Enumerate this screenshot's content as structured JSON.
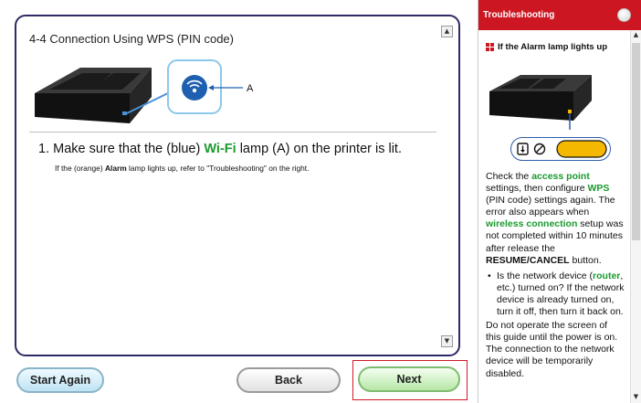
{
  "main": {
    "title": "4-4 Connection Using WPS (PIN code)",
    "callout_label": "A",
    "step": {
      "number": "1.",
      "text_before": "Make sure that the (blue) ",
      "text_highlight": "Wi-Fi",
      "text_after": " lamp (A) on the printer is lit."
    },
    "note": {
      "before": "If the (orange) ",
      "bold": "Alarm",
      "after": " lamp lights up, refer to \"Troubleshooting\" on the right."
    }
  },
  "buttons": {
    "start_again": "Start Again",
    "back": "Back",
    "next": "Next"
  },
  "troubleshooting": {
    "title": "Troubleshooting",
    "heading": "If the Alarm lamp lights up",
    "p1": {
      "t1": "Check the ",
      "g1": "access point",
      "t2": " settings, then configure ",
      "g2": "WPS",
      "t3": " (PIN code) settings again. The error also appears when ",
      "g3": "wireless connection",
      "t4": " setup was not completed within 10 minutes after release the ",
      "b1": "RESUME/CANCEL",
      "t5": " button."
    },
    "bullet": {
      "t1": "Is the network device (",
      "g1": "router",
      "t2": ", etc.) turned on? If the network device is already turned on, turn it off, then turn it back on."
    },
    "p2": "Do not operate the screen of this guide until the power is on. The connection to the network device will be temporarily disabled."
  },
  "colors": {
    "panel_border": "#2e2a66",
    "accent_red": "#cc1722",
    "highlight_green": "#1a9a2e",
    "wifi_lamp": "#1e5fb0",
    "alarm_lamp": "#f5b800"
  },
  "icons": {
    "wifi_lamp": "wifi-icon",
    "alarm_lamp": "alarm-lamp-icon",
    "resume": "resume-icon",
    "stop": "stop-icon",
    "close": "close-icon"
  }
}
